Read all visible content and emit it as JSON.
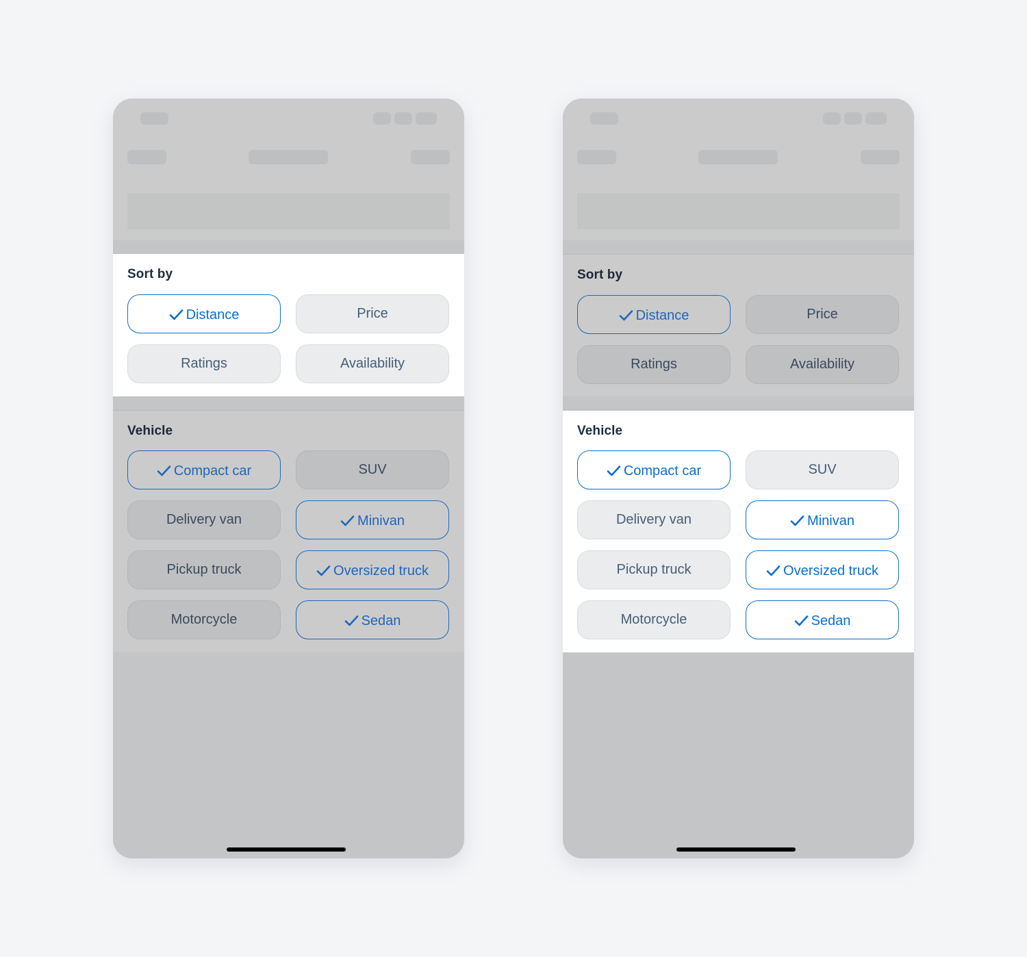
{
  "colors": {
    "accent": "#0a6ed1",
    "chip_text": "#475e75",
    "title_text": "#1d2d3e",
    "scrim": "#cbcbcb",
    "background": "#f4f5f7"
  },
  "phones": [
    {
      "variant": "sort-by-focused",
      "sort_by": {
        "title": "Sort by",
        "options": [
          {
            "label": "Distance",
            "selected": true,
            "icon": "check-icon"
          },
          {
            "label": "Price",
            "selected": false
          },
          {
            "label": "Ratings",
            "selected": false
          },
          {
            "label": "Availability",
            "selected": false
          }
        ]
      },
      "vehicle": {
        "title": "Vehicle",
        "options": [
          {
            "label": "Compact car",
            "selected": true,
            "icon": "check-icon"
          },
          {
            "label": "SUV",
            "selected": false
          },
          {
            "label": "Delivery van",
            "selected": false
          },
          {
            "label": "Minivan",
            "selected": true,
            "icon": "check-icon"
          },
          {
            "label": "Pickup truck",
            "selected": false
          },
          {
            "label": "Oversized truck",
            "selected": true,
            "icon": "check-icon"
          },
          {
            "label": "Motorcycle",
            "selected": false
          },
          {
            "label": "Sedan",
            "selected": true,
            "icon": "check-icon"
          }
        ]
      }
    },
    {
      "variant": "vehicle-focused",
      "sort_by": {
        "title": "Sort by",
        "options": [
          {
            "label": "Distance",
            "selected": true,
            "icon": "check-icon"
          },
          {
            "label": "Price",
            "selected": false
          },
          {
            "label": "Ratings",
            "selected": false
          },
          {
            "label": "Availability",
            "selected": false
          }
        ]
      },
      "vehicle": {
        "title": "Vehicle",
        "options": [
          {
            "label": "Compact car",
            "selected": true,
            "icon": "check-icon"
          },
          {
            "label": "SUV",
            "selected": false
          },
          {
            "label": "Delivery van",
            "selected": false
          },
          {
            "label": "Minivan",
            "selected": true,
            "icon": "check-icon"
          },
          {
            "label": "Pickup truck",
            "selected": false
          },
          {
            "label": "Oversized truck",
            "selected": true,
            "icon": "check-icon"
          },
          {
            "label": "Motorcycle",
            "selected": false
          },
          {
            "label": "Sedan",
            "selected": true,
            "icon": "check-icon"
          }
        ]
      }
    }
  ]
}
